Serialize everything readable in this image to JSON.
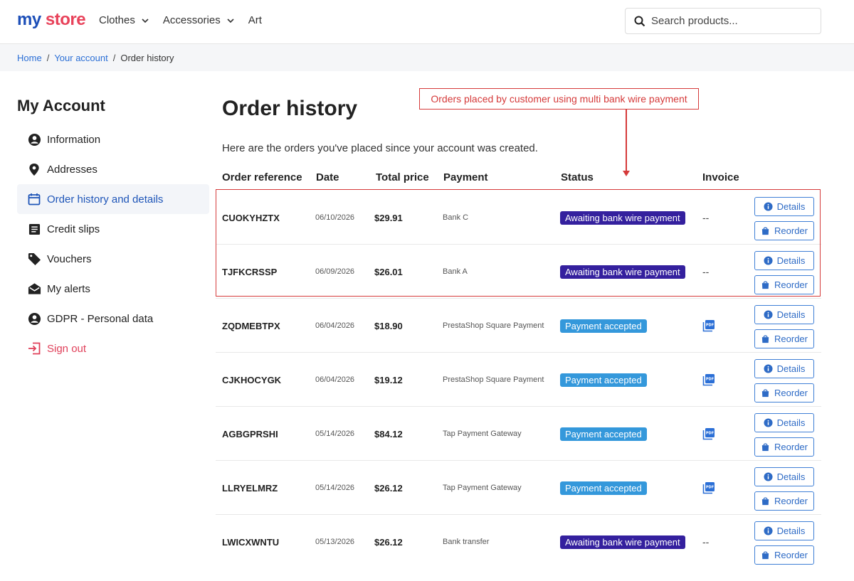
{
  "header": {
    "logo_part1": "my",
    "logo_part2": "store",
    "nav": [
      {
        "label": "Clothes",
        "has_dropdown": true
      },
      {
        "label": "Accessories",
        "has_dropdown": true
      },
      {
        "label": "Art",
        "has_dropdown": false
      }
    ],
    "search_placeholder": "Search products..."
  },
  "breadcrumb": {
    "items": [
      "Home",
      "Your account"
    ],
    "current": "Order history"
  },
  "sidebar": {
    "title": "My Account",
    "items": [
      {
        "label": "Information",
        "icon": "user-circle-icon"
      },
      {
        "label": "Addresses",
        "icon": "location-pin-icon"
      },
      {
        "label": "Order history and details",
        "icon": "calendar-icon",
        "active": true
      },
      {
        "label": "Credit slips",
        "icon": "document-icon"
      },
      {
        "label": "Vouchers",
        "icon": "tag-icon"
      },
      {
        "label": "My alerts",
        "icon": "envelope-icon"
      },
      {
        "label": "GDPR - Personal data",
        "icon": "user-circle-icon"
      },
      {
        "label": "Sign out",
        "icon": "sign-out-icon"
      }
    ]
  },
  "main": {
    "title": "Order history",
    "intro": "Here are the orders you've placed since your account was created.",
    "annotation": "Orders placed by customer using multi bank wire payment",
    "columns": [
      "Order reference",
      "Date",
      "Total price",
      "Payment",
      "Status",
      "Invoice"
    ],
    "details_label": "Details",
    "reorder_label": "Reorder",
    "orders": [
      {
        "ref": "CUOKYHZTX",
        "date": "06/10/2026",
        "price": "$29.91",
        "payment": "Bank C",
        "status": "Awaiting bank wire payment",
        "status_color": "#34209e",
        "invoice": "--"
      },
      {
        "ref": "TJFKCRSSP",
        "date": "06/09/2026",
        "price": "$26.01",
        "payment": "Bank A",
        "status": "Awaiting bank wire payment",
        "status_color": "#34209e",
        "invoice": "--"
      },
      {
        "ref": "ZQDMEBTPX",
        "date": "06/04/2026",
        "price": "$18.90",
        "payment": "PrestaShop Square Payment",
        "status": "Payment accepted",
        "status_color": "#3498db",
        "invoice": "pdf-icon"
      },
      {
        "ref": "CJKHOCYGK",
        "date": "06/04/2026",
        "price": "$19.12",
        "payment": "PrestaShop Square Payment",
        "status": "Payment accepted",
        "status_color": "#3498db",
        "invoice": "pdf-icon"
      },
      {
        "ref": "AGBGPRSHI",
        "date": "05/14/2026",
        "price": "$84.12",
        "payment": "Tap Payment Gateway",
        "status": "Payment accepted",
        "status_color": "#3498db",
        "invoice": "pdf-icon"
      },
      {
        "ref": "LLRYELMRZ",
        "date": "05/14/2026",
        "price": "$26.12",
        "payment": "Tap Payment Gateway",
        "status": "Payment accepted",
        "status_color": "#3498db",
        "invoice": "pdf-icon"
      },
      {
        "ref": "LWICXWNTU",
        "date": "05/13/2026",
        "price": "$26.12",
        "payment": "Bank transfer",
        "status": "Awaiting bank wire payment",
        "status_color": "#34209e",
        "invoice": "--"
      }
    ]
  }
}
